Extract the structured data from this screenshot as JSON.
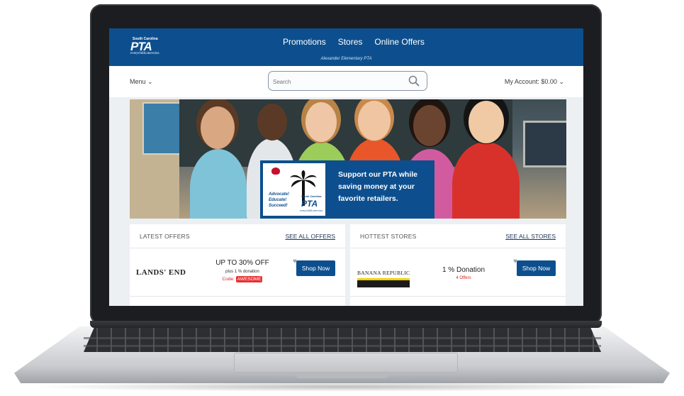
{
  "header": {
    "logo": {
      "state": "South Carolina",
      "name": "PTA",
      "tagline": "everychild.onevoice."
    },
    "nav": [
      "Promotions",
      "Stores",
      "Online Offers"
    ],
    "subtitle": "Alexander Elementary PTA"
  },
  "toolbar": {
    "menu_label": "Menu",
    "search_placeholder": "Search",
    "account_label": "My Account: $0.00"
  },
  "hero": {
    "logo_lines": [
      "Advocate!",
      "Educate!",
      "Succeed!"
    ],
    "logo_state": "South Carolina",
    "logo_name": "PTA",
    "logo_tagline": "everychild.onevoice.",
    "message": "Support our PTA while saving money at your favorite retailers."
  },
  "latest_offers": {
    "title": "LATEST OFFERS",
    "see_all": "SEE ALL OFFERS",
    "items": [
      {
        "brand": "LANDS' END",
        "headline": "UP TO 30% OFF",
        "detail": "plus 1 % donation",
        "code_label": "Code:",
        "code": "AWESOME",
        "button": "Shop Now"
      }
    ]
  },
  "hottest_stores": {
    "title": "HOTTEST STORES",
    "see_all": "SEE ALL STORES",
    "items": [
      {
        "brand": "BANANA REPUBLIC",
        "donation": "1 % Donation",
        "offers": "4 Offers",
        "button": "Shop Now"
      }
    ]
  },
  "colors": {
    "brand_blue": "#0d4f8e",
    "accent_red": "#e63033",
    "page_bg": "#ecf0f3"
  }
}
